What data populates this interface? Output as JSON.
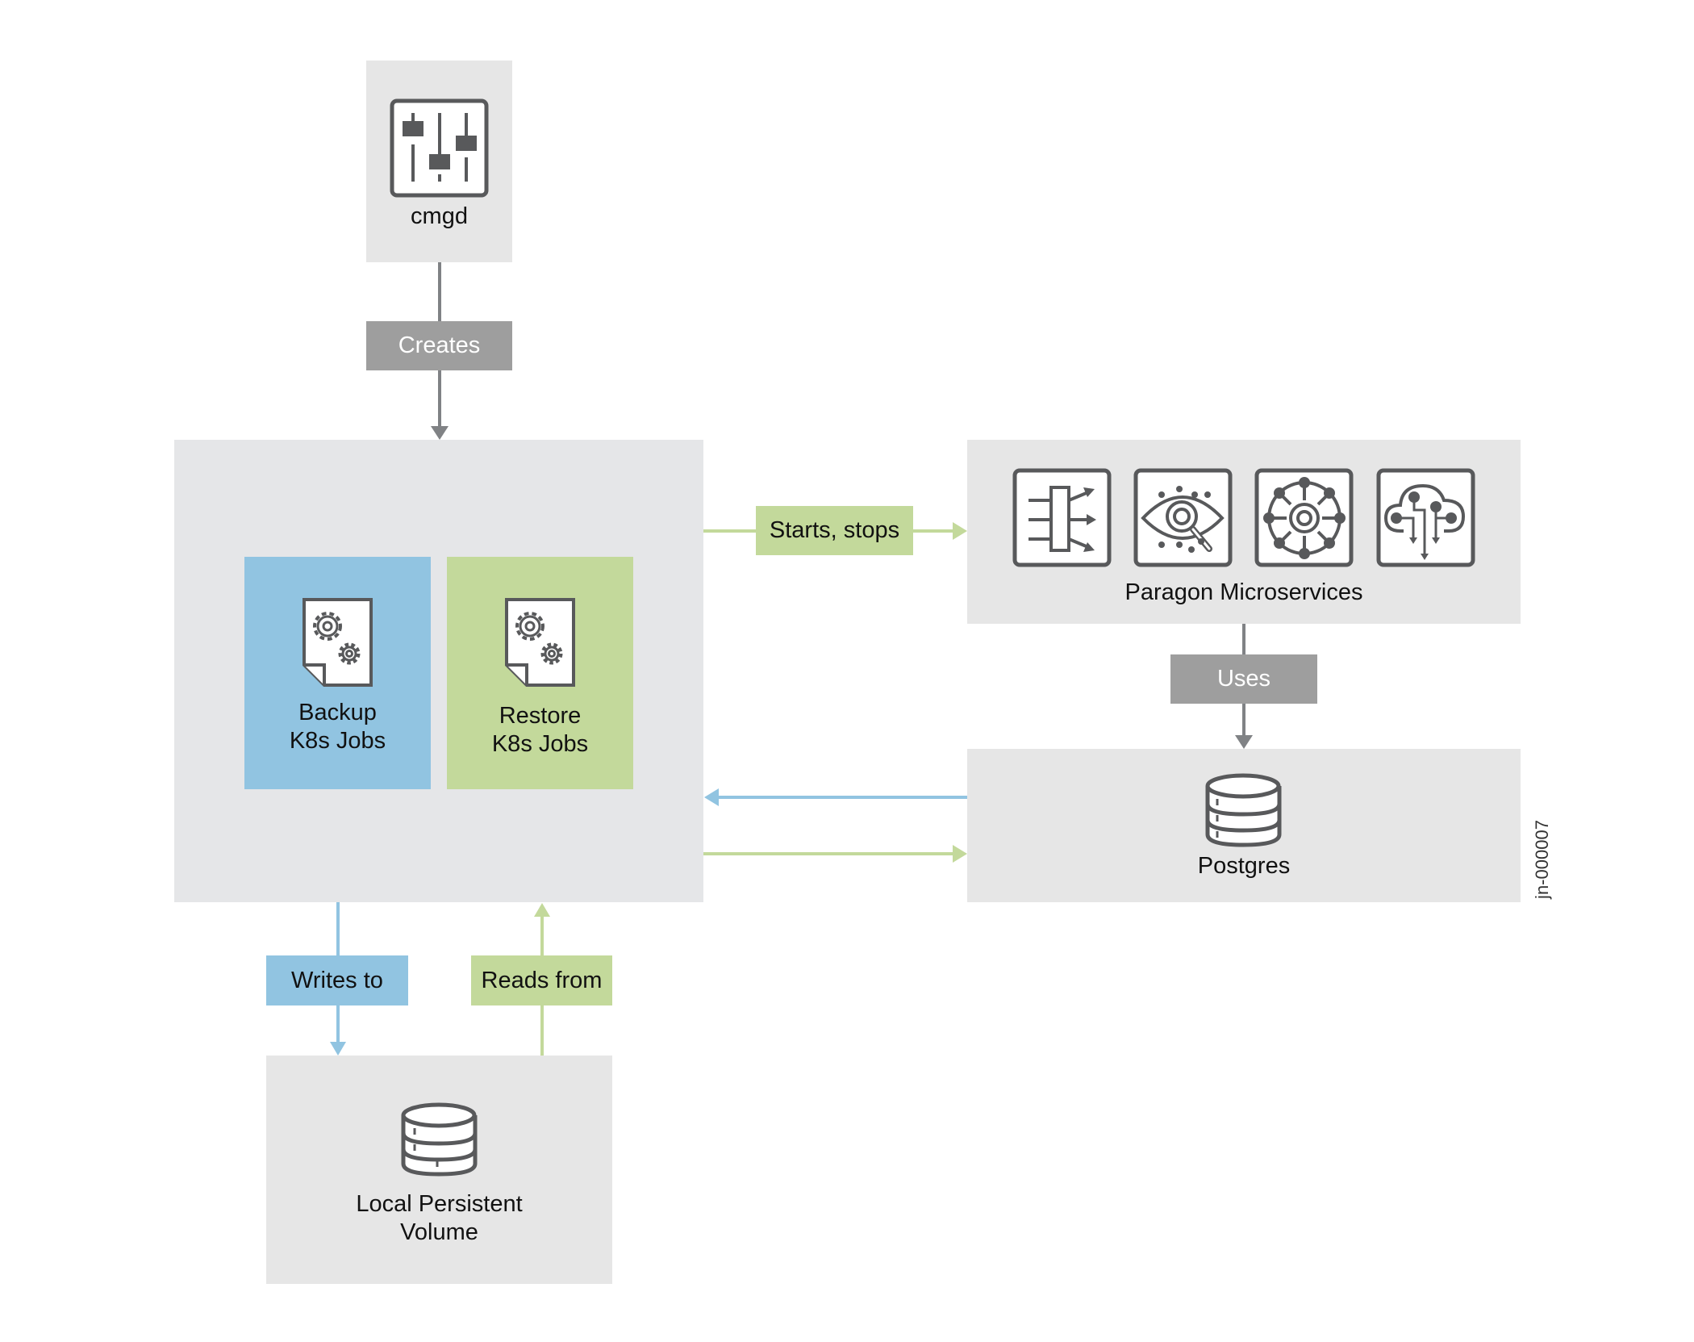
{
  "nodes": {
    "cmgd": {
      "label": "cmgd",
      "icon": "sliders-icon"
    },
    "k8s_jobs_container": {
      "backup": {
        "line1": "Backup",
        "line2": "K8s Jobs",
        "icon": "gear-document-icon"
      },
      "restore": {
        "line1": "Restore",
        "line2": "K8s Jobs",
        "icon": "gear-document-icon"
      }
    },
    "paragon": {
      "label": "Paragon Microservices",
      "icons": [
        "load-balancer-icon",
        "eye-analytics-icon",
        "network-hub-icon",
        "cloud-circuit-icon"
      ]
    },
    "postgres": {
      "label": "Postgres",
      "icon": "database-icon"
    },
    "local_volume": {
      "line1": "Local Persistent",
      "line2": "Volume",
      "icon": "database-icon"
    }
  },
  "edges": {
    "creates": "Creates",
    "starts_stops": "Starts, stops",
    "uses": "Uses",
    "writes_to": "Writes to",
    "reads_from": "Reads from"
  },
  "figure_id": "jn-000007",
  "colors": {
    "panel": "#e6e6e6",
    "blue": "#91c4e1",
    "green": "#c3d99b",
    "label_gray": "#9e9e9e",
    "icon_dark": "#58595b",
    "arrow_gray": "#808285"
  }
}
